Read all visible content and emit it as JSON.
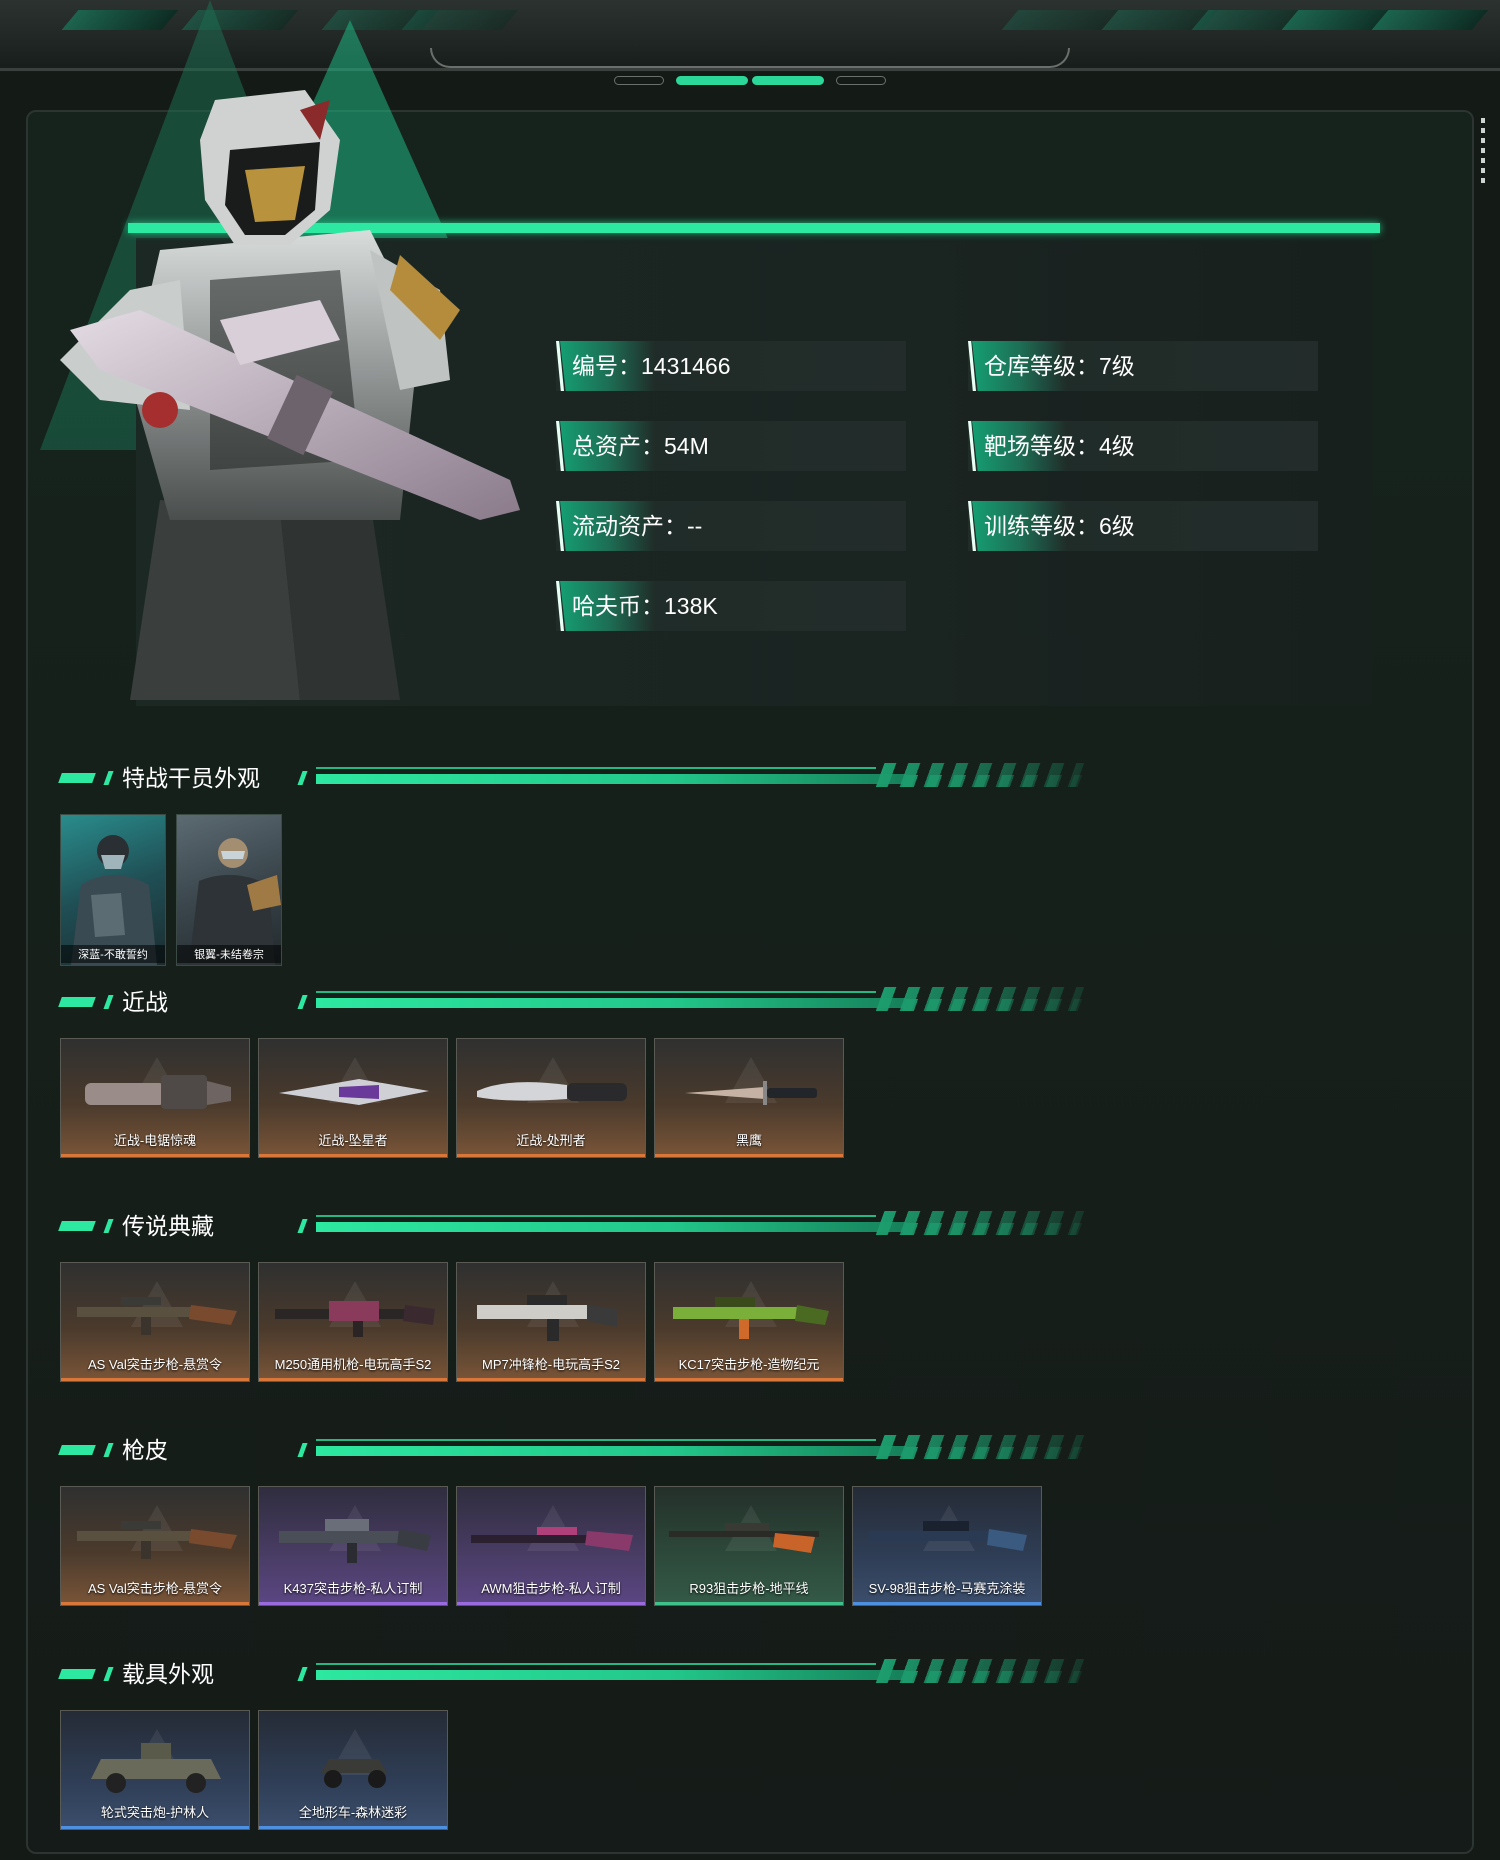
{
  "profile": {
    "stats_left": [
      {
        "label": "编号：1431466"
      },
      {
        "label": "总资产：54M"
      },
      {
        "label": "流动资产：--"
      },
      {
        "label": "哈夫币：138K"
      }
    ],
    "stats_right": [
      {
        "label": "仓库等级：7级"
      },
      {
        "label": "靶场等级：4级"
      },
      {
        "label": "训练等级：6级"
      }
    ]
  },
  "sections": {
    "operators": {
      "title": "特战干员外观",
      "items": [
        {
          "name": "深蓝-不敢誓约"
        },
        {
          "name": "银翼-未结卷宗"
        }
      ]
    },
    "melee": {
      "title": "近战",
      "items": [
        {
          "name": "近战-电锯惊魂",
          "rarity": "orange"
        },
        {
          "name": "近战-坠星者",
          "rarity": "orange"
        },
        {
          "name": "近战-处刑者",
          "rarity": "orange"
        },
        {
          "name": "黑鹰",
          "rarity": "orange"
        }
      ]
    },
    "legendary": {
      "title": "传说典藏",
      "items": [
        {
          "name": "AS Val突击步枪-悬赏令",
          "rarity": "orange"
        },
        {
          "name": "M250通用机枪-电玩高手S2",
          "rarity": "orange"
        },
        {
          "name": "MP7冲锋枪-电玩高手S2",
          "rarity": "orange"
        },
        {
          "name": "KC17突击步枪-造物纪元",
          "rarity": "orange"
        }
      ]
    },
    "skins": {
      "title": "枪皮",
      "items": [
        {
          "name": "AS Val突击步枪-悬赏令",
          "rarity": "orange"
        },
        {
          "name": "K437突击步枪-私人订制",
          "rarity": "purple"
        },
        {
          "name": "AWM狙击步枪-私人订制",
          "rarity": "purple"
        },
        {
          "name": "R93狙击步枪-地平线",
          "rarity": "green"
        },
        {
          "name": "SV-98狙击步枪-马赛克涂装",
          "rarity": "blue"
        }
      ]
    },
    "vehicles": {
      "title": "载具外观",
      "items": [
        {
          "name": "轮式突击炮-护林人",
          "rarity": "blue"
        },
        {
          "name": "全地形车-森林迷彩",
          "rarity": "blue"
        }
      ]
    }
  },
  "colors": {
    "accent": "#2de8a0",
    "orange": "#d9773a",
    "purple": "#9a6bdf",
    "green": "#3fbf8a",
    "blue": "#4d8fe0"
  }
}
